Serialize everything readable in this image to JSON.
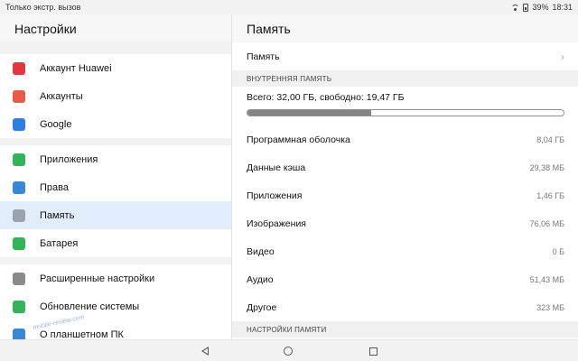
{
  "status_bar": {
    "left_text": "Только экстр. вызов",
    "battery": "39%",
    "time": "18:31"
  },
  "left": {
    "title": "Настройки",
    "groups": [
      [
        {
          "label": "Аккаунт Huawei",
          "icon": "huawei-icon",
          "color": "#e0383e"
        },
        {
          "label": "Аккаунты",
          "icon": "accounts-icon",
          "color": "#ea5a48"
        },
        {
          "label": "Google",
          "icon": "google-icon",
          "color": "#2f7de1"
        }
      ],
      [
        {
          "label": "Приложения",
          "icon": "apps-icon",
          "color": "#34b35a"
        },
        {
          "label": "Права",
          "icon": "key-icon",
          "color": "#3a86d6"
        },
        {
          "label": "Память",
          "icon": "storage-icon",
          "color": "#9aa3ad",
          "active": true
        },
        {
          "label": "Батарея",
          "icon": "battery-icon",
          "color": "#34b35a"
        }
      ],
      [
        {
          "label": "Расширенные настройки",
          "icon": "gear-icon",
          "color": "#8a8a8a"
        },
        {
          "label": "Обновление системы",
          "icon": "update-icon",
          "color": "#34b35a"
        },
        {
          "label": "О планшетном ПК",
          "icon": "tablet-icon",
          "color": "#3a86d6"
        }
      ]
    ]
  },
  "right": {
    "title": "Память",
    "memory_row_label": "Память",
    "internal_section": "ВНУТРЕННЯЯ ПАМЯТЬ",
    "storage_summary": "Всего: 32,00 ГБ, свободно: 19,47 ГБ",
    "storage_used_fraction": 0.39,
    "items": [
      {
        "label": "Программная оболочка",
        "value": "8,04 ГБ"
      },
      {
        "label": "Данные кэша",
        "value": "29,38 МБ"
      },
      {
        "label": "Приложения",
        "value": "1,46 ГБ"
      },
      {
        "label": "Изображения",
        "value": "76,06 МБ"
      },
      {
        "label": "Видео",
        "value": "0 Б"
      },
      {
        "label": "Аудио",
        "value": "51,43 МБ"
      },
      {
        "label": "Другое",
        "value": "323 МБ"
      }
    ],
    "settings_section": "НАСТРОЙКИ ПАМЯТИ"
  },
  "watermark": "mobile-review.com"
}
